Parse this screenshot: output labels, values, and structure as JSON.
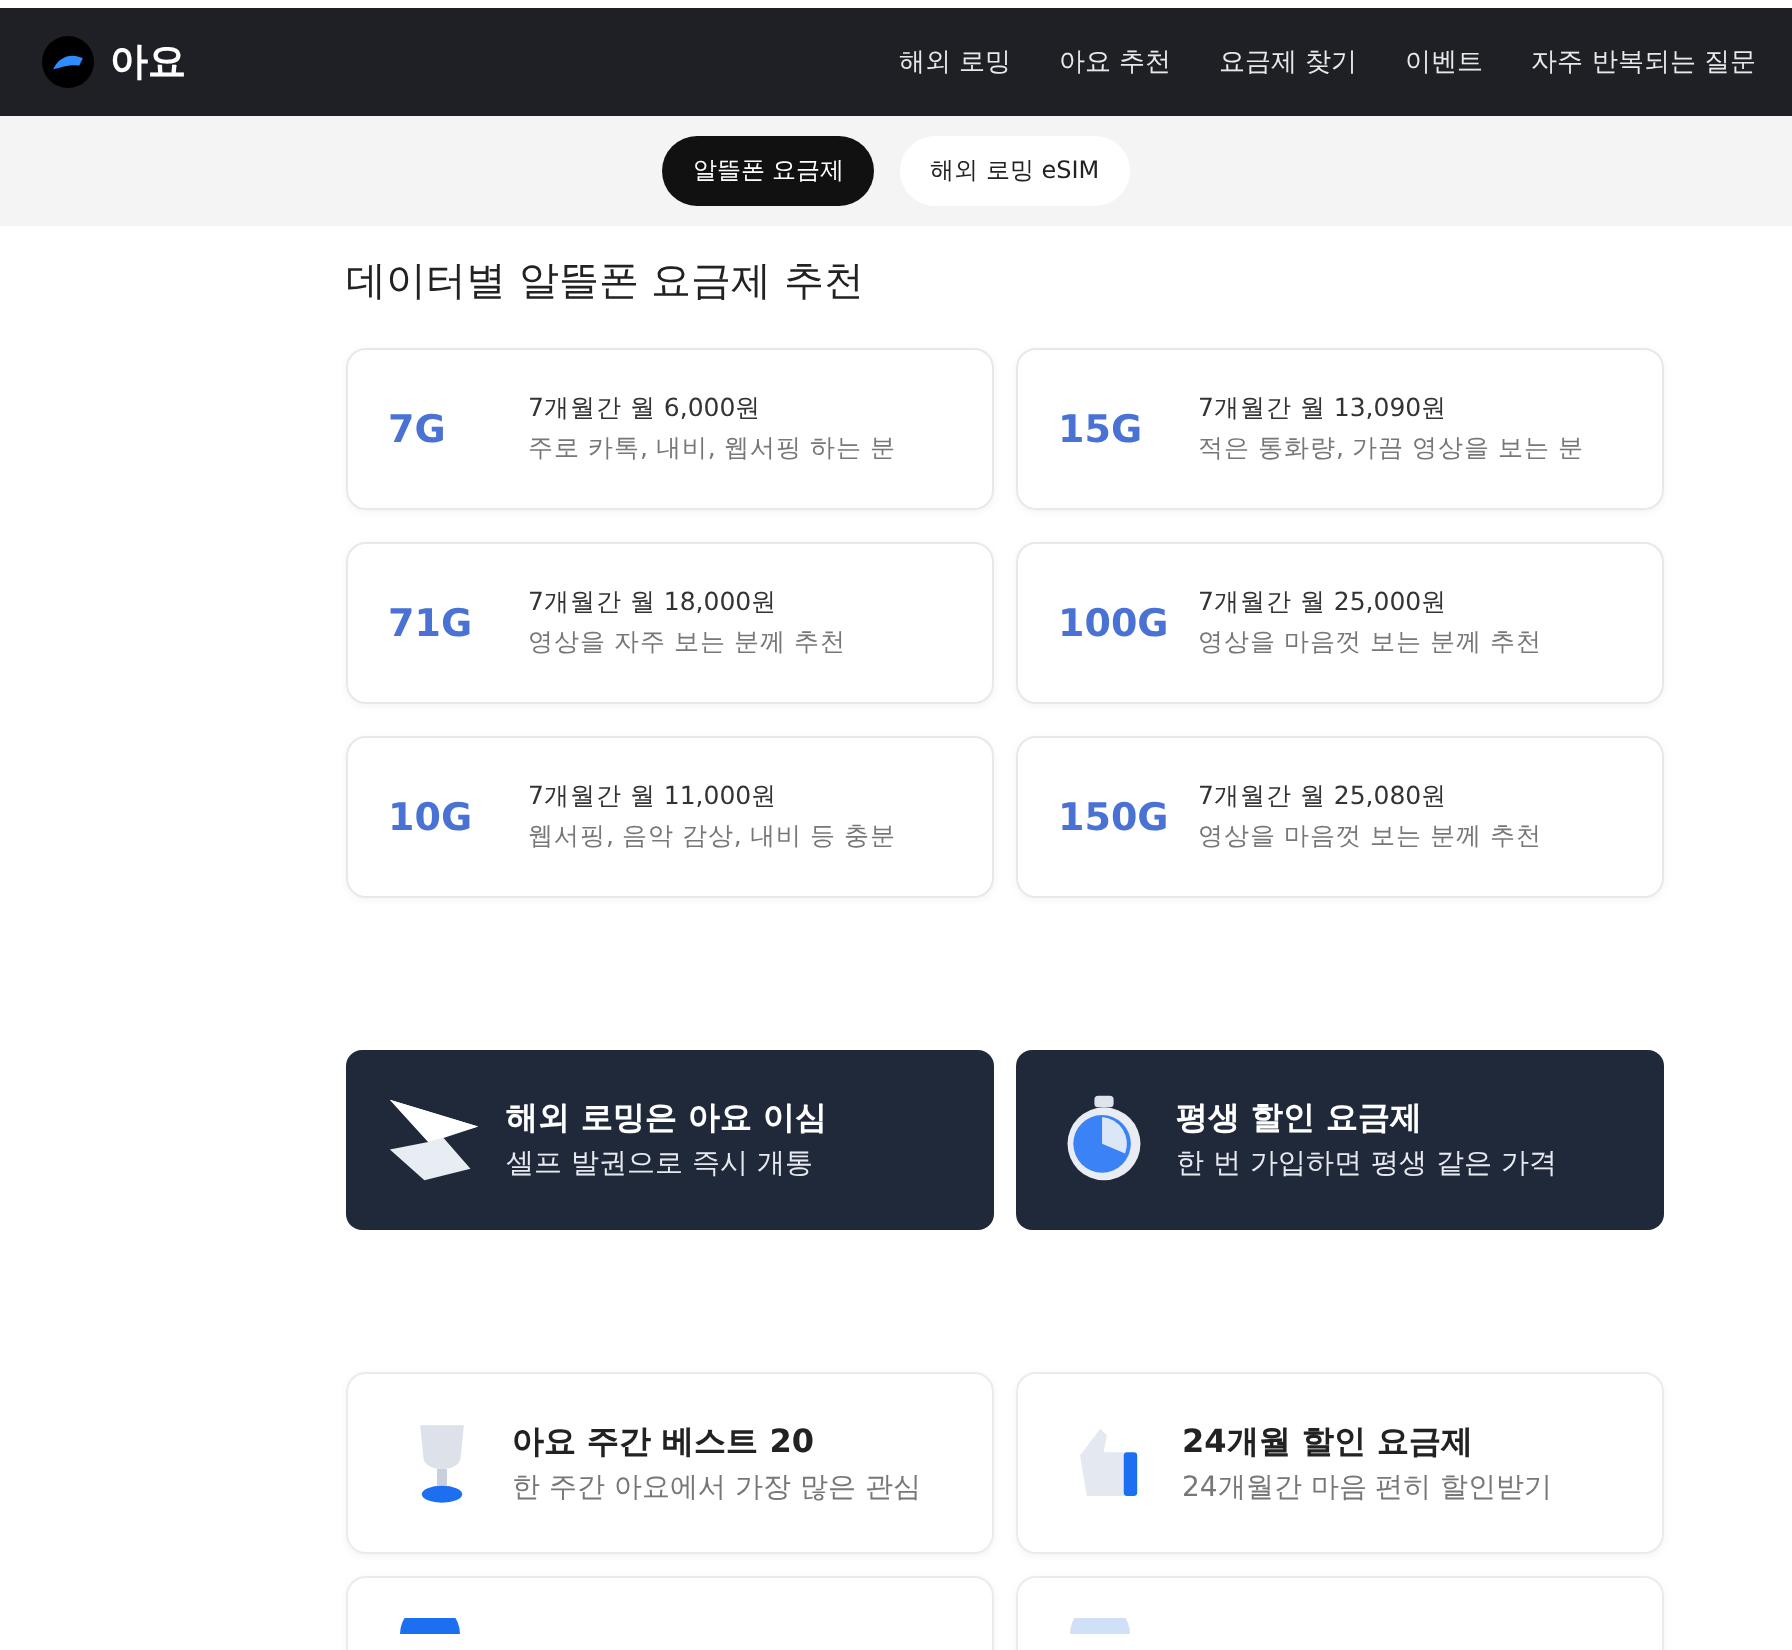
{
  "header": {
    "logo_text": "아요",
    "nav": [
      {
        "label": "해외 로밍"
      },
      {
        "label": "아요 추천"
      },
      {
        "label": "요금제 찾기"
      },
      {
        "label": "이벤트"
      },
      {
        "label": "자주 반복되는 질문"
      }
    ]
  },
  "tabs": [
    {
      "label": "알뜰폰 요금제",
      "selected": true
    },
    {
      "label": "해외 로밍 eSIM",
      "selected": false
    }
  ],
  "section_title": "데이터별 알뜰폰 요금제 추천",
  "plans": [
    {
      "data": "7G",
      "price": "7개월간 월 6,000원",
      "desc": "주로 카톡, 내비, 웹서핑 하는 분"
    },
    {
      "data": "15G",
      "price": "7개월간 월 13,090원",
      "desc": "적은 통화량, 가끔 영상을 보는 분"
    },
    {
      "data": "71G",
      "price": "7개월간 월 18,000원",
      "desc": "영상을 자주 보는 분께 추천"
    },
    {
      "data": "100G",
      "price": "7개월간 월 25,000원",
      "desc": "영상을 마음껏 보는 분께 추천"
    },
    {
      "data": "10G",
      "price": "7개월간 월 11,000원",
      "desc": "웹서핑, 음악 감상, 내비 등 충분"
    },
    {
      "data": "150G",
      "price": "7개월간 월 25,080원",
      "desc": "영상을 마음껏 보는 분께 추천"
    }
  ],
  "promos": [
    {
      "kind": "plane",
      "title": "해외 로밍은 아요 이심",
      "subtitle": "셀프 발권으로 즉시 개통"
    },
    {
      "kind": "timer",
      "title": "평생 할인 요금제",
      "subtitle": "한 번 가입하면 평생 같은 가격"
    }
  ],
  "features": [
    {
      "kind": "trophy",
      "title": "아요 주간 베스트 20",
      "subtitle": "한 주간 아요에서 가장 많은 관심"
    },
    {
      "kind": "thumb",
      "title": "24개월 할인 요금제",
      "subtitle": "24개월간 마음 편히 할인받기"
    },
    {
      "kind": "ball"
    },
    {
      "kind": "globe"
    }
  ]
}
